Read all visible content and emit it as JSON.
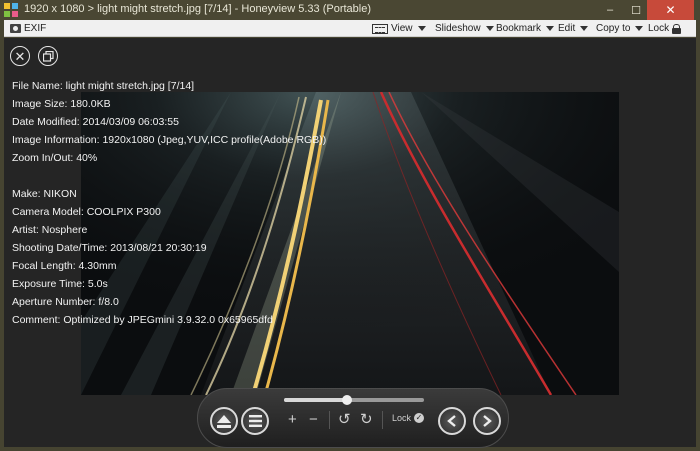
{
  "window": {
    "title": "1920 x 1080 > light might stretch.jpg [7/14] - Honeyview 5.33 (Portable)",
    "minimize_glyph": "–",
    "maximize_glyph": "☐",
    "close_glyph": "✕"
  },
  "toolbar": {
    "exif_label": "EXIF",
    "view_label": "View",
    "slideshow_label": "Slideshow",
    "bookmark_label": "Bookmark",
    "edit_label": "Edit",
    "copyto_label": "Copy to",
    "lock_label": "Lock"
  },
  "info": {
    "file_name": "File Name: light might stretch.jpg [7/14]",
    "image_size": "Image Size: 180.0KB",
    "date_modified": "Date Modified: 2014/03/09 06:03:55",
    "image_information": "Image Information: 1920x1080 (Jpeg,YUV,ICC profile(Adobe RGB))",
    "zoom": "Zoom In/Out: 40%",
    "make": "Make: NIKON",
    "camera_model": "Camera Model: COOLPIX P300",
    "artist": "Artist: Nosphere",
    "shooting_datetime": "Shooting Date/Time: 2013/08/21 20:30:19",
    "focal_length": "Focal Length: 4.30mm",
    "exposure_time": "Exposure Time: 5.0s",
    "aperture": "Aperture Number: f/8.0",
    "comment": "Comment: Optimized by JPEGmini 3.9.32.0 0x65965dfd"
  },
  "controls": {
    "lock_label": "Lock",
    "slider_position": 0.45,
    "zoom_in_glyph": "+",
    "zoom_out_glyph": "−",
    "rotate_left_glyph": "↺",
    "rotate_right_glyph": "↻"
  },
  "colors": {
    "title_bar": "#4a4733",
    "close_button": "#c74a3a",
    "viewer_bg": "#252525"
  }
}
